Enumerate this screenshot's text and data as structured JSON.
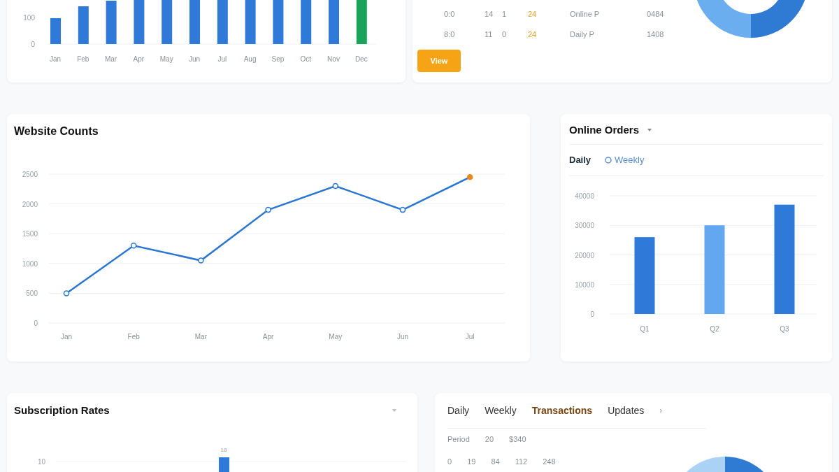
{
  "top_chart": {
    "y_tick_labels": [
      "100",
      "0"
    ],
    "x_labels": [
      "Jan",
      "Feb",
      "Mar",
      "Apr",
      "May",
      "Jun",
      "Jul",
      "Aug",
      "Sep",
      "Oct",
      "Nov",
      "Dec"
    ]
  },
  "top_table": {
    "rows": [
      {
        "time": "0:0",
        "a": "14",
        "b": "1",
        "count": "24",
        "label": "Online P",
        "total": "0484"
      },
      {
        "time": "8:0",
        "a": "11",
        "b": "0",
        "count": "24",
        "label": "Daily P",
        "total": "1408"
      }
    ],
    "button": "View"
  },
  "website_counts": {
    "title": "Website Counts",
    "chart_data": {
      "type": "line",
      "categories": [
        "Jan",
        "Feb",
        "Mar",
        "Apr",
        "May",
        "Jun",
        "Jul"
      ],
      "series": [
        {
          "color": "#2a76d2",
          "values": [
            500,
            1300,
            1050,
            1900,
            2300,
            1900,
            2450
          ]
        }
      ],
      "ylim": [
        0,
        2500
      ],
      "yticks": [
        0,
        500,
        1000,
        1500,
        2000,
        2500
      ],
      "grid": true,
      "marker": true
    }
  },
  "online_orders": {
    "title": "Online Orders",
    "tabs": [
      {
        "label": "Daily",
        "selected": true
      },
      {
        "label": "Weekly",
        "selected": false
      }
    ],
    "chart_data": {
      "type": "bar",
      "categories": [
        "Q1",
        "Q2",
        "Q3"
      ],
      "series": [
        {
          "color": "#2f7ad8",
          "values": [
            26000,
            null,
            37000
          ]
        },
        {
          "color": "#62a7ef",
          "values": [
            null,
            30000,
            null
          ]
        }
      ],
      "ylim": [
        0,
        40000
      ],
      "yticks": [
        0,
        10000,
        20000,
        30000,
        40000
      ],
      "grid": true
    }
  },
  "subscription_rates": {
    "title": "Subscription Rates",
    "y_tick_label": "10",
    "bar_value_label": "18"
  },
  "transactions": {
    "tabs": [
      {
        "label": "Daily",
        "selected": false
      },
      {
        "label": "Weekly",
        "selected": false
      },
      {
        "label": "Transactions",
        "selected": true
      },
      {
        "label": "Updates",
        "selected": false
      }
    ],
    "more": "›",
    "lines": [
      {
        "items": [
          "Period",
          "20",
          "$340"
        ]
      },
      {
        "items": [
          "0",
          "19",
          "84",
          "112",
          "248"
        ]
      }
    ]
  }
}
